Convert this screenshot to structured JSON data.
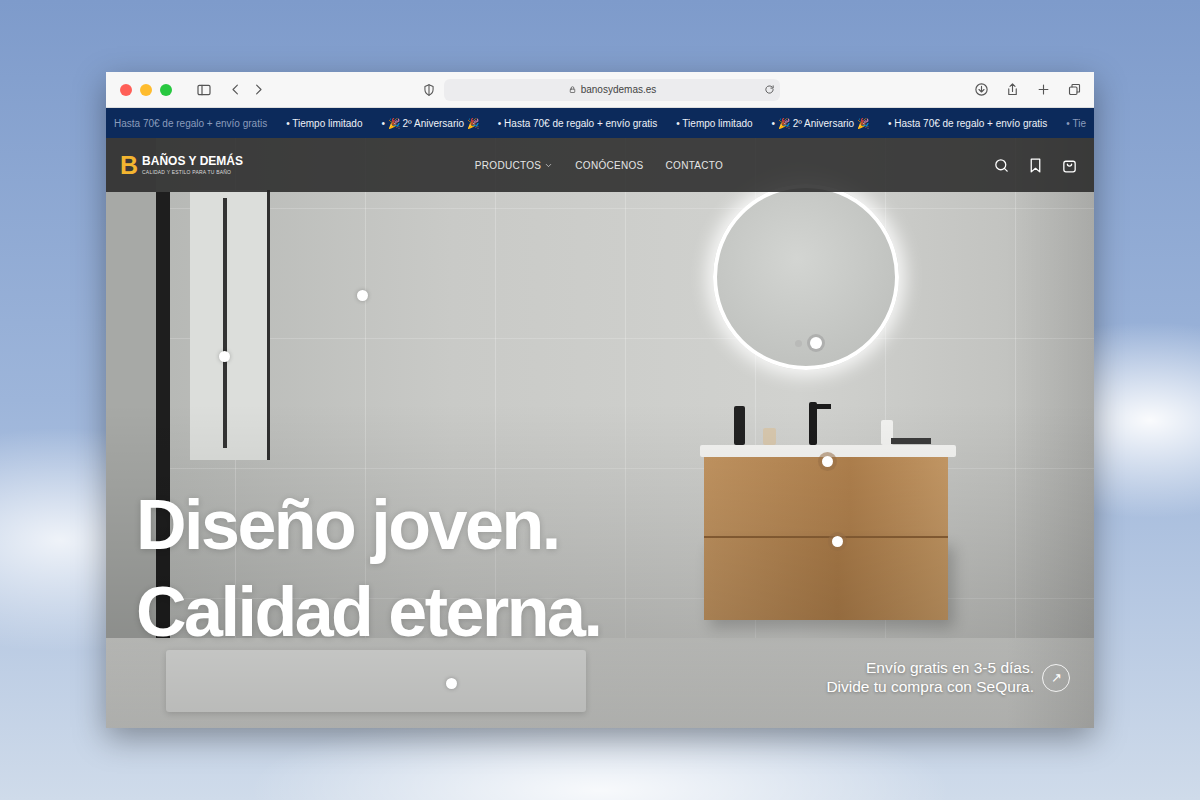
{
  "window": {
    "url": "banosydemas.es"
  },
  "announcement": [
    {
      "text": "Hasta 70€ de regalo + envío gratis",
      "faded": true
    },
    {
      "text": "• Tiempo limitado",
      "faded": false
    },
    {
      "text": "• 🎉 2º Aniversario 🎉",
      "faded": false
    },
    {
      "text": "• Hasta 70€ de regalo + envío gratis",
      "faded": false
    },
    {
      "text": "• Tiempo limitado",
      "faded": false
    },
    {
      "text": "• 🎉 2º Aniversario 🎉",
      "faded": false
    },
    {
      "text": "• Hasta 70€ de regalo + envío gratis",
      "faded": false
    },
    {
      "text": "• Tie",
      "faded": true
    }
  ],
  "brand": {
    "mark": "B",
    "name": "BAÑOS Y DEMÁS",
    "tagline": "CALIDAD Y ESTILO PARA TU BAÑO"
  },
  "nav": [
    {
      "label": "PRODUCTOS",
      "dropdown": true
    },
    {
      "label": "CONÓCENOS",
      "dropdown": false
    },
    {
      "label": "CONTACTO",
      "dropdown": false
    }
  ],
  "hero": {
    "headline": [
      "Diseño joven.",
      "Calidad eterna."
    ],
    "info": [
      "Envío gratis en 3-5 días.",
      "Divide tu compra con SeQura."
    ],
    "arrow": "↗",
    "slides": [
      {
        "selected": false
      },
      {
        "selected": true
      }
    ]
  }
}
